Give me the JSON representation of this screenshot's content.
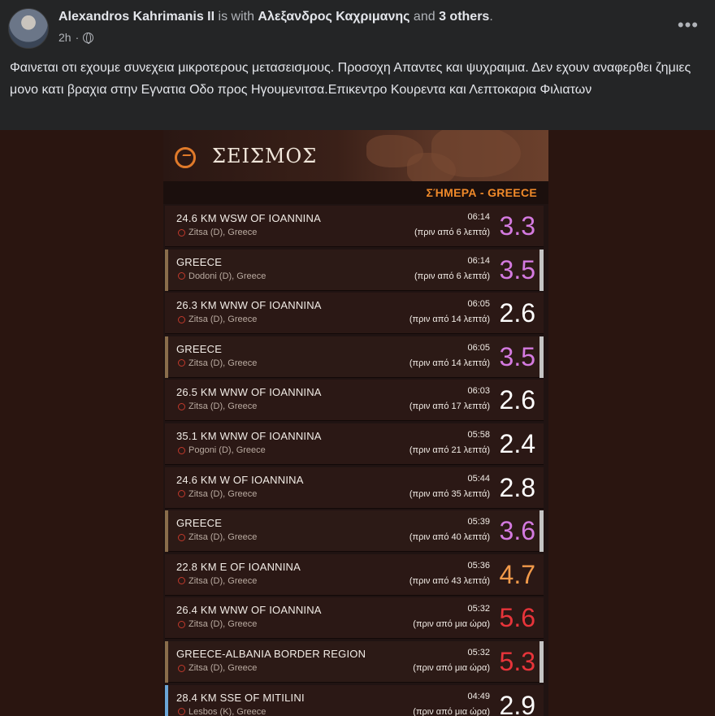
{
  "post": {
    "author": "Alexandros Kahrimanis II",
    "with_text": "is with",
    "tagged": "Αλεξανδρος Καχριμανης",
    "and_text": "and",
    "others": "3 others",
    "time": "2h",
    "dot": "·",
    "more": "•••",
    "text": "Φαινεται οτι εχουμε συνεχεια μικροτερους μετασεισμους. Προσοχη Απαντες και ψυχραιμια. Δεν εχουν αναφερθει ζημιες μονο κατι βραχια στην Εγνατια Οδο προς Ηγουμενιτσα.Επικεντρο Κουρεντα και Λεπτοκαρια Φιλιατων"
  },
  "app": {
    "title": "ΣΕΙΣΜΟΣ",
    "section": "ΣΉΜΕΡΑ - GREECE",
    "accent": "#f08a2a"
  },
  "colors": {
    "purple": "#d47ae0",
    "white": "#ffffff",
    "orange": "#f29a4a",
    "red": "#e8343a"
  },
  "quakes": [
    {
      "place": "24.6 KM WSW OF IOANNINA",
      "area": "Zitsa (D), Greece",
      "time": "06:14",
      "ago": "(πριν από 6 λεπτά)",
      "mag": "3.3",
      "color": "purple",
      "hl": false,
      "bar": "none"
    },
    {
      "place": "GREECE",
      "area": "Dodoni (D), Greece",
      "time": "06:14",
      "ago": "(πριν από 6 λεπτά)",
      "mag": "3.5",
      "color": "purple",
      "hl": true,
      "bar": "tan"
    },
    {
      "place": "26.3 KM WNW OF IOANNINA",
      "area": "Zitsa (D), Greece",
      "time": "06:05",
      "ago": "(πριν από 14 λεπτά)",
      "mag": "2.6",
      "color": "white",
      "hl": false,
      "bar": "none"
    },
    {
      "place": "GREECE",
      "area": "Zitsa (D), Greece",
      "time": "06:05",
      "ago": "(πριν από 14 λεπτά)",
      "mag": "3.5",
      "color": "purple",
      "hl": true,
      "bar": "tan"
    },
    {
      "place": "26.5 KM WNW OF IOANNINA",
      "area": "Zitsa (D), Greece",
      "time": "06:03",
      "ago": "(πριν από 17 λεπτά)",
      "mag": "2.6",
      "color": "white",
      "hl": false,
      "bar": "none"
    },
    {
      "place": "35.1 KM WNW OF IOANNINA",
      "area": "Pogoni (D), Greece",
      "time": "05:58",
      "ago": "(πριν από 21 λεπτά)",
      "mag": "2.4",
      "color": "white",
      "hl": false,
      "bar": "none"
    },
    {
      "place": "24.6 KM W OF IOANNINA",
      "area": "Zitsa (D), Greece",
      "time": "05:44",
      "ago": "(πριν από 35 λεπτά)",
      "mag": "2.8",
      "color": "white",
      "hl": false,
      "bar": "none"
    },
    {
      "place": "GREECE",
      "area": "Zitsa (D), Greece",
      "time": "05:39",
      "ago": "(πριν από 40 λεπτά)",
      "mag": "3.6",
      "color": "purple",
      "hl": true,
      "bar": "tan"
    },
    {
      "place": "22.8 KM E OF IOANNINA",
      "area": "Zitsa (D), Greece",
      "time": "05:36",
      "ago": "(πριν από 43 λεπτά)",
      "mag": "4.7",
      "color": "orange",
      "hl": false,
      "bar": "none"
    },
    {
      "place": "26.4 KM WNW OF IOANNINA",
      "area": "Zitsa (D), Greece",
      "time": "05:32",
      "ago": "(πριν από μια ώρα)",
      "mag": "5.6",
      "color": "red",
      "hl": false,
      "bar": "none"
    },
    {
      "place": "GREECE-ALBANIA BORDER REGION",
      "area": "Zitsa (D), Greece",
      "time": "05:32",
      "ago": "(πριν από μια ώρα)",
      "mag": "5.3",
      "color": "red",
      "hl": true,
      "bar": "tan"
    },
    {
      "place": "28.4 KM SSE OF MITILINI",
      "area": "Lesbos (K), Greece",
      "time": "04:49",
      "ago": "(πριν από μια ώρα)",
      "mag": "2.9",
      "color": "white",
      "hl": false,
      "bar": "blue"
    }
  ]
}
